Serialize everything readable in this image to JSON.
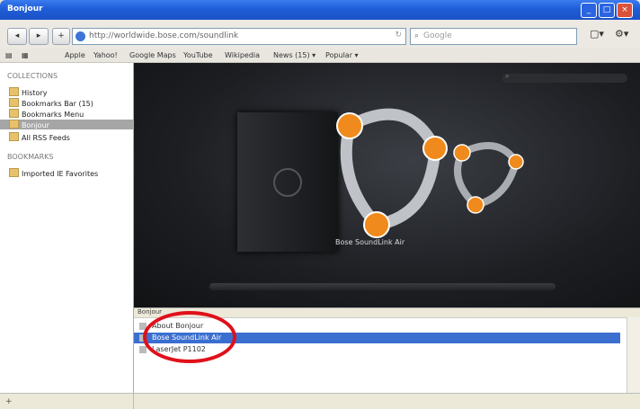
{
  "window": {
    "title": "Bonjour",
    "minimize": "_",
    "maximize": "□",
    "close": "×"
  },
  "nav": {
    "back": "◂",
    "forward": "▸",
    "reload": "+",
    "url": "http://worldwide.bose.com/soundlink",
    "search_placeholder": "Google",
    "page_menu": "▢▾",
    "tools_menu": "⚙▾"
  },
  "bookmarks_bar": [
    "Apple",
    "Yahoo!",
    "Google Maps",
    "YouTube",
    "Wikipedia",
    "News (15) ▾",
    "Popular ▾"
  ],
  "sidebar": {
    "collections_heading": "COLLECTIONS",
    "collections": [
      "History",
      "Bookmarks Bar (15)",
      "Bookmarks Menu",
      "Bonjour",
      "All RSS Feeds"
    ],
    "selected_index": 3,
    "bookmarks_heading": "BOOKMARKS",
    "bookmarks": [
      "Imported IE Favorites"
    ]
  },
  "preview": {
    "caption": "Bose SoundLink Air"
  },
  "list": {
    "header": "Bonjour",
    "rows": [
      "About Bonjour",
      "Bose SoundLink Air",
      "LaserJet P1102"
    ],
    "selected_index": 1
  },
  "colors": {
    "selection": "#3b6fcf",
    "highlight_circle": "#e0101a"
  }
}
